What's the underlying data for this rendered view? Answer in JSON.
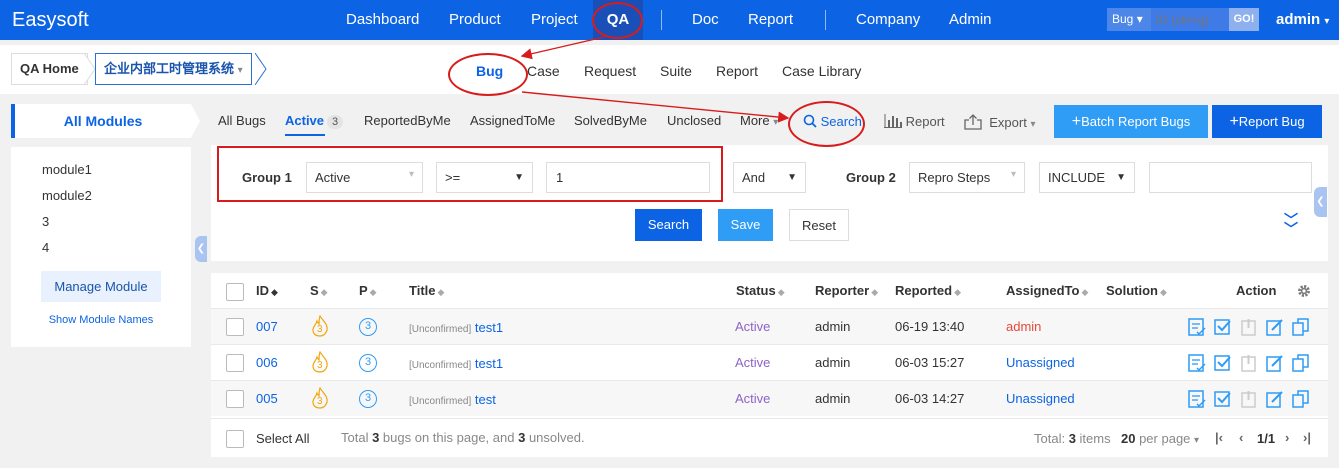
{
  "app": {
    "logo": "Easysoft"
  },
  "topnav": {
    "items": [
      "Dashboard",
      "Product",
      "Project",
      "QA",
      "Doc",
      "Report",
      "Company",
      "Admin"
    ],
    "active": "QA"
  },
  "quick_search": {
    "type": "Bug",
    "placeholder": "ID (ctrl+g)",
    "go": "GO!"
  },
  "user": {
    "name": "admin"
  },
  "breadcrumb": {
    "home": "QA Home",
    "system": "企业内部工时管理系统"
  },
  "subnav": {
    "items": [
      "Bug",
      "Case",
      "Request",
      "Suite",
      "Report",
      "Case Library"
    ],
    "active": "Bug"
  },
  "sidebar": {
    "title": "All Modules",
    "modules": [
      "module1",
      "module2",
      "3",
      "4"
    ],
    "manage_button": "Manage Module",
    "show_names": "Show Module Names"
  },
  "filter_tabs": {
    "all_bugs": "All Bugs",
    "active": "Active",
    "active_count": "3",
    "reported_by_me": "ReportedByMe",
    "assigned_to_me": "AssignedToMe",
    "solved_by_me": "SolvedByMe",
    "unclosed": "Unclosed",
    "more": "More"
  },
  "toolbar": {
    "search": "Search",
    "report": "Report",
    "export": "Export",
    "batch_report": "Batch Report Bugs",
    "report_bug": "Report Bug"
  },
  "search_panel": {
    "group1_label": "Group 1",
    "group1_field": "Active",
    "group1_operator": ">=",
    "group1_value": "1",
    "logic": "And",
    "group2_label": "Group 2",
    "group2_field": "Repro Steps",
    "group2_operator": "INCLUDE",
    "group2_value": "",
    "search_btn": "Search",
    "save_btn": "Save",
    "reset_btn": "Reset"
  },
  "table": {
    "columns": {
      "id": "ID",
      "severity": "S",
      "priority": "P",
      "title": "Title",
      "status": "Status",
      "reporter": "Reporter",
      "reported": "Reported",
      "assigned_to": "AssignedTo",
      "solution": "Solution",
      "action": "Action"
    },
    "rows": [
      {
        "id": "007",
        "severity": "3",
        "priority": "3",
        "tag": "[Unconfirmed]",
        "title": "test1",
        "status": "Active",
        "reporter": "admin",
        "reported": "06-19 13:40",
        "assigned_to": "admin",
        "solution": ""
      },
      {
        "id": "006",
        "severity": "3",
        "priority": "3",
        "tag": "[Unconfirmed]",
        "title": "test1",
        "status": "Active",
        "reporter": "admin",
        "reported": "06-03 15:27",
        "assigned_to": "Unassigned",
        "solution": ""
      },
      {
        "id": "005",
        "severity": "3",
        "priority": "3",
        "tag": "[Unconfirmed]",
        "title": "test",
        "status": "Active",
        "reporter": "admin",
        "reported": "06-03 14:27",
        "assigned_to": "Unassigned",
        "solution": ""
      }
    ]
  },
  "footer": {
    "select_all": "Select All",
    "summary_prefix": "Total ",
    "summary_bugs": "3",
    "summary_mid": " bugs on this page, and ",
    "summary_unsolved": "3",
    "summary_suffix": " unsolved.",
    "total_prefix": "Total: ",
    "total_count": "3",
    "total_suffix": " items",
    "per_page_count": "20",
    "per_page_suffix": " per page",
    "page": "1/1"
  },
  "colors": {
    "primary": "#0c64e4",
    "light_blue": "#2f9cf6",
    "annotation": "#d81c1c",
    "status_active": "#8e63c7",
    "assigned_admin": "#e7493b"
  }
}
